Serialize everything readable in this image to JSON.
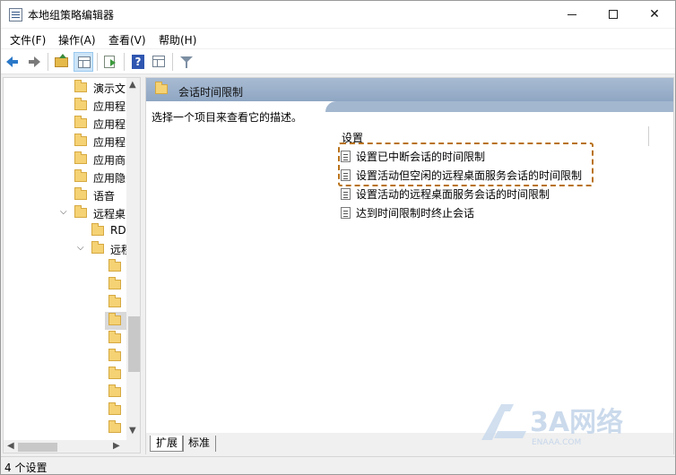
{
  "window": {
    "title": "本地组策略编辑器"
  },
  "menu": [
    "文件(F)",
    "操作(A)",
    "查看(V)",
    "帮助(H)"
  ],
  "toolbar": {
    "icons": [
      "back-arrow-icon",
      "forward-arrow-icon",
      "folder-up-icon",
      "show-hide-tree-icon",
      "export-list-icon",
      "help-icon",
      "properties-icon",
      "filter-icon"
    ]
  },
  "tree": {
    "items": [
      {
        "label": "演示文",
        "level": 0,
        "expanded": false
      },
      {
        "label": "应用程",
        "level": 0,
        "expanded": false
      },
      {
        "label": "应用程",
        "level": 0,
        "expanded": false
      },
      {
        "label": "应用程",
        "level": 0,
        "expanded": false
      },
      {
        "label": "应用商",
        "level": 0,
        "expanded": false
      },
      {
        "label": "应用隐",
        "level": 0,
        "expanded": false
      },
      {
        "label": "语音",
        "level": 0,
        "expanded": false
      },
      {
        "label": "远程桌",
        "level": 0,
        "expanded": true
      },
      {
        "label": "RD",
        "level": 1,
        "expanded": false
      },
      {
        "label": "远程",
        "level": 1,
        "expanded": true
      },
      {
        "label": "",
        "level": 2
      },
      {
        "label": "",
        "level": 2
      },
      {
        "label": "",
        "level": 2
      },
      {
        "label": "",
        "level": 2,
        "selected": true
      },
      {
        "label": "",
        "level": 2
      },
      {
        "label": "",
        "level": 2
      },
      {
        "label": "",
        "level": 2
      },
      {
        "label": "",
        "level": 2
      },
      {
        "label": "",
        "level": 2
      },
      {
        "label": "",
        "level": 2
      }
    ]
  },
  "right": {
    "header_title": "会话时间限制",
    "description": "选择一个项目来查看它的描述。",
    "column_header": "设置",
    "settings": [
      "设置已中断会话的时间限制",
      "设置活动但空闲的远程桌面服务会话的时间限制",
      "设置活动的远程桌面服务会话的时间限制",
      "达到时间限制时终止会话"
    ],
    "tabs": [
      "扩展",
      "标准"
    ]
  },
  "status": {
    "text": "4 个设置"
  },
  "watermark": {
    "text": "3A网络",
    "subtext": "ENAAA.COM"
  },
  "colors": {
    "header_gradient": "#a3b7cf",
    "highlight_border": "#b9721a",
    "folder": "#f5d274"
  }
}
